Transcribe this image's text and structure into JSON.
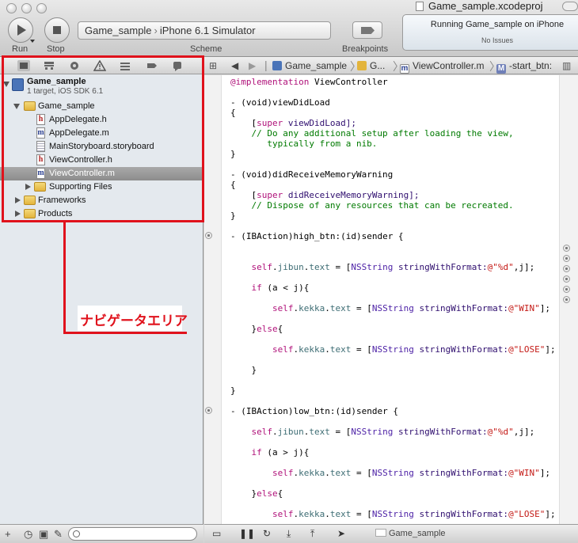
{
  "window": {
    "title": "Game_sample.xcodeproj"
  },
  "toolbar": {
    "run_label": "Run",
    "stop_label": "Stop",
    "scheme_target": "Game_sample",
    "scheme_separator": "›",
    "scheme_destination": "iPhone 6.1 Simulator",
    "scheme_label": "Scheme",
    "breakpoints_label": "Breakpoints",
    "activity_status": "Running Game_sample on iPhone",
    "activity_issues": "No Issues"
  },
  "navigator": {
    "tabs": [
      "folder-icon",
      "hierarchy-icon",
      "search-icon",
      "warning-icon",
      "debug-icon",
      "breakpoint-icon",
      "log-icon"
    ],
    "project": {
      "name": "Game_sample",
      "subtitle": "1 target, iOS SDK 6.1"
    },
    "items": [
      {
        "label": "Game_sample",
        "type": "folder"
      },
      {
        "label": "AppDelegate.h",
        "type": "h"
      },
      {
        "label": "AppDelegate.m",
        "type": "m"
      },
      {
        "label": "MainStoryboard.storyboard",
        "type": "storyboard"
      },
      {
        "label": "ViewController.h",
        "type": "h"
      },
      {
        "label": "ViewController.m",
        "type": "m",
        "selected": true
      },
      {
        "label": "Supporting Files",
        "type": "folder"
      },
      {
        "label": "Frameworks",
        "type": "folder"
      },
      {
        "label": "Products",
        "type": "folder"
      }
    ],
    "annotation": "ナビゲータエリア",
    "filter_placeholder": ""
  },
  "jump_bar": {
    "crumb_project": "Game_sample",
    "crumb_group": "G...",
    "crumb_file": "ViewController.m",
    "crumb_method": "-start_btn:",
    "file_badge": "m",
    "method_badge": "M"
  },
  "code": {
    "lines": [
      [
        "@implementation",
        " ViewController"
      ],
      [
        "- (void)",
        "viewDidLoad"
      ],
      [
        "{"
      ],
      [
        "    [",
        "super",
        " viewDidLoad];"
      ],
      [
        "    // Do any additional setup after loading the view,"
      ],
      [
        "       typically from a nib."
      ],
      [
        "}"
      ],
      [
        "- (void)",
        "didReceiveMemoryWarning"
      ],
      [
        "{"
      ],
      [
        "    [",
        "super",
        " didReceiveMemoryWarning];"
      ],
      [
        "    // Dispose of any resources that can be recreated."
      ],
      [
        "}"
      ],
      [
        "- (IBAction)",
        "high_btn:(id)sender {"
      ],
      [
        "    ",
        "self",
        ".",
        "jibun",
        ".",
        "text",
        " = [",
        "NSString",
        " ",
        "stringWithFormat:",
        "@\"%d\"",
        ",j];"
      ],
      [
        "    ",
        "if",
        " (a < j){"
      ],
      [
        "        ",
        "self",
        ".",
        "kekka",
        ".",
        "text",
        " = [",
        "NSString",
        " ",
        "stringWithFormat:",
        "@\"WIN\"",
        "];"
      ],
      [
        "    }",
        "else",
        "{"
      ],
      [
        "        ",
        "self",
        ".",
        "kekka",
        ".",
        "text",
        " = [",
        "NSString",
        " ",
        "stringWithFormat:",
        "@\"LOSE\"",
        "];"
      ],
      [
        "    }"
      ],
      [
        "}"
      ],
      [
        "- (IBAction)",
        "low_btn:(id)sender {"
      ],
      [
        "    ",
        "self",
        ".",
        "jibun",
        ".",
        "text",
        " = [",
        "NSString",
        " ",
        "stringWithFormat:",
        "@\"%d\"",
        ",j];"
      ],
      [
        "    ",
        "if",
        " (a > j){"
      ],
      [
        "        ",
        "self",
        ".",
        "kekka",
        ".",
        "text",
        " = [",
        "NSString",
        " ",
        "stringWithFormat:",
        "@\"WIN\"",
        "];"
      ],
      [
        "    }",
        "else",
        "{"
      ],
      [
        "        ",
        "self",
        ".",
        "kekka",
        ".",
        "text",
        " = [",
        "NSString",
        " ",
        "stringWithFormat:",
        "@\"LOSE\"",
        "];"
      ]
    ]
  },
  "debug_bar": {
    "target": "Game_sample"
  },
  "colors": {
    "annotation_red": "#e0121c",
    "keyword": "#b0127a",
    "string": "#c41a16",
    "comment": "#007a00",
    "class": "#4b1fa5"
  }
}
